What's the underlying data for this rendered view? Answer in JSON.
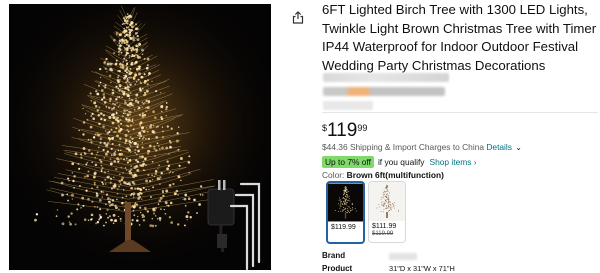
{
  "product": {
    "title": "6FT Lighted Birch Tree with 1300 LED Lights, Twinkle Light Brown Christmas Tree with Timer IP44 Waterproof for Indoor Outdoor Festival Wedding Party Christmas Decorations",
    "image_icon": "tree-lights-photo",
    "share_icon": "share-icon"
  },
  "price": {
    "symbol": "$",
    "whole": "119",
    "fraction": "99"
  },
  "shipping": {
    "text": "$44.36 Shipping & Import Charges to China",
    "details_link": "Details",
    "chevron": "⌄"
  },
  "promo": {
    "badge": "Up to 7% off",
    "text": "if you qualify",
    "link": "Shop items ›",
    "badge_color": "#7fda69"
  },
  "color": {
    "label": "Color:",
    "value": "Brown 6ft(multifunction)"
  },
  "swatches": [
    {
      "price": "$119.99",
      "old_price": "",
      "selected": true
    },
    {
      "price": "$111.99",
      "old_price": "$119.99",
      "selected": false
    }
  ],
  "specs": {
    "brand_label": "Brand",
    "product_label": "Product",
    "product_value": "31\"D x 31\"W x 71\"H"
  },
  "colors": {
    "link": "#007185",
    "selected_border": "#2162a1",
    "text": "#0f1111"
  }
}
